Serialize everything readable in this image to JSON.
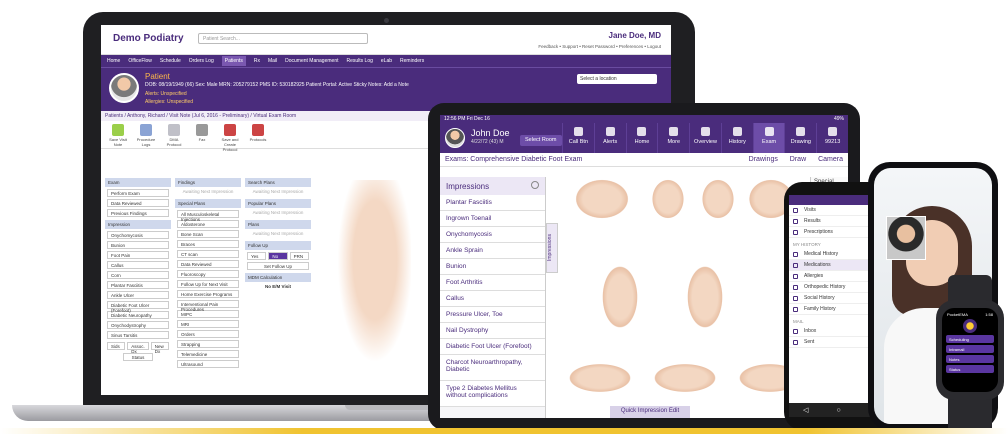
{
  "colors": {
    "brand": "#4a2c7c",
    "accent": "#f0c330",
    "link": "#3a7ac8"
  },
  "laptop": {
    "logo": "Demo Podiatry",
    "search_placeholder": "Patient Search...",
    "user": "Jane Doe, MD",
    "links": "Feedback • Support • Reset Password • Preferences • Logout",
    "nav": [
      "Home",
      "OfficeFlow",
      "Schedule",
      "Orders Log",
      "Patients",
      "Rx",
      "Mail",
      "Document Management",
      "Results Log",
      "eLab",
      "Reminders"
    ],
    "active_nav": "Patients",
    "patient": {
      "title": "Patient",
      "info": "DOB: 08/19/1949 (66)   Sex: Male   MRN: 205279152   PMS ID: 530182925   Patient Portal: Active   Sticky Notes: Add a Note",
      "alert": "Alerts: Unspecified",
      "allergies": "Allergies: Unspecified",
      "location": "Select a location"
    },
    "breadcrumb": "Patients / Anthony, Richard / Visit Note (Jul 6, 2016 - Preliminary) / Virtual Exam Room",
    "tools": [
      {
        "label": "Save Visit Note",
        "icon": "check-icon"
      },
      {
        "label": "Procedure Logs",
        "icon": "log-icon"
      },
      {
        "label": "DMA Protocol",
        "icon": "doc-icon"
      },
      {
        "label": "Fax",
        "icon": "fax-icon"
      },
      {
        "label": "Save and Create Protocol",
        "icon": "save-icon"
      },
      {
        "label": "Protocols",
        "icon": "protocol-icon"
      }
    ],
    "exam": {
      "title": "Exam",
      "items": [
        "Perform Exam",
        "Data Reviewed",
        "Previous Findings"
      ]
    },
    "impression": {
      "title": "Impression",
      "items": [
        "Onychomycosis",
        "Bunion",
        "Foot Pain",
        "Callus",
        "Corn",
        "Plantar Fasciitis",
        "Ankle Ulcer",
        "Diabetic Foot Ulcer (Forefoot)",
        "Diabetic Neuropathy",
        "Onychodystrophy",
        "Sinus Tarsitis"
      ],
      "footer": [
        "Sids",
        "Assoc. Dx",
        "New Dx"
      ],
      "status": "Status"
    },
    "findings": {
      "title": "Findings",
      "ghost": "Awaiting Next Impression"
    },
    "special": {
      "title": "Special Plans",
      "items": [
        "All Musculoskeletal Injections",
        "Aldosterone",
        "Bone Scan",
        "Braces",
        "CT scan",
        "Data Reviewed",
        "Fluoroscopy",
        "Follow Up for Next Visit",
        "Home Exercise Programs",
        "Interventional Pain Procedures",
        "MIPC",
        "MRI",
        "Orders",
        "Strapping",
        "Telemedicine",
        "Ultrasound"
      ]
    },
    "search": {
      "title": "Search Plans",
      "ghost": "Awaiting Next Impression"
    },
    "popular": {
      "title": "Popular Plans",
      "ghost": "Awaiting Next Impression"
    },
    "plans": {
      "title": "Plans",
      "ghost": "Awaiting Next Impression"
    },
    "follow": {
      "title": "Follow Up",
      "opts": [
        "Yes",
        "No",
        "PRN"
      ],
      "btn": "Set Follow Up"
    },
    "mdm": {
      "title": "MDM Calculation",
      "value": "No E/M Visit"
    },
    "done_btn": "Done with this"
  },
  "tablet": {
    "status_left": "12:56 PM  Fri Dec 16",
    "status_right": "49%",
    "name": "John Doe",
    "dob": "4/22/72 (43) M",
    "select_room": "Select Room",
    "nav": [
      {
        "label": "Call Btn",
        "icon": "list-icon"
      },
      {
        "label": "Alerts",
        "icon": "flag-icon"
      },
      {
        "label": "Home",
        "icon": "home-icon"
      },
      {
        "label": "More",
        "icon": "dots-icon"
      },
      {
        "label": "Overview",
        "icon": "info-icon"
      },
      {
        "label": "History",
        "icon": "clock-icon"
      },
      {
        "label": "Exam",
        "icon": "stethoscope-icon"
      },
      {
        "label": "Drawing",
        "icon": "pen-icon"
      },
      {
        "label": "99213",
        "icon": "tree-icon"
      }
    ],
    "active_nav": "Exam",
    "exam_title": "Exams: Comprehensive Diabetic Foot Exam",
    "sub_links": [
      "Drawings",
      "Draw",
      "Camera"
    ],
    "impressions_title": "Impressions",
    "impressions_tab": "Impressions",
    "impressions": [
      "Plantar Fasciitis",
      "Ingrown Toenail",
      "Onychomycosis",
      "Ankle Sprain",
      "Bunion",
      "Foot Arthritis",
      "Callus",
      "Pressure Ulcer, Toe",
      "Nail Dystrophy",
      "Diabetic Foot Ulcer (Forefoot)",
      "Charcot Neuroarthropathy, Diabetic",
      "Type 2 Diabetes Mellitus without complications"
    ],
    "quick_btn": "Quick Impression Edit",
    "right_label": "Special",
    "right_btn": "S"
  },
  "phone": {
    "items": [
      {
        "label": "Visits",
        "icon": "visit-icon"
      },
      {
        "label": "Results",
        "icon": "results-icon"
      },
      {
        "label": "Prescriptions",
        "icon": "rx-icon"
      }
    ],
    "section1": "MY HISTORY",
    "history": [
      {
        "label": "Medical History",
        "icon": "medical-icon"
      },
      {
        "label": "Medications",
        "icon": "pill-icon"
      },
      {
        "label": "Allergies",
        "icon": "allergy-icon"
      },
      {
        "label": "Orthopedic History",
        "icon": "bone-icon"
      },
      {
        "label": "Social History",
        "icon": "social-icon"
      },
      {
        "label": "Family History",
        "icon": "family-icon"
      }
    ],
    "selected": "Medications",
    "section2": "MAIL",
    "mail": [
      {
        "label": "Inbox",
        "icon": "inbox-icon"
      },
      {
        "label": "Sent",
        "icon": "sent-icon"
      }
    ]
  },
  "watch": {
    "app": "PocketEMA",
    "time": "1:58",
    "buttons": [
      "Scheduling",
      "Intramail",
      "Notes",
      "Status"
    ]
  }
}
